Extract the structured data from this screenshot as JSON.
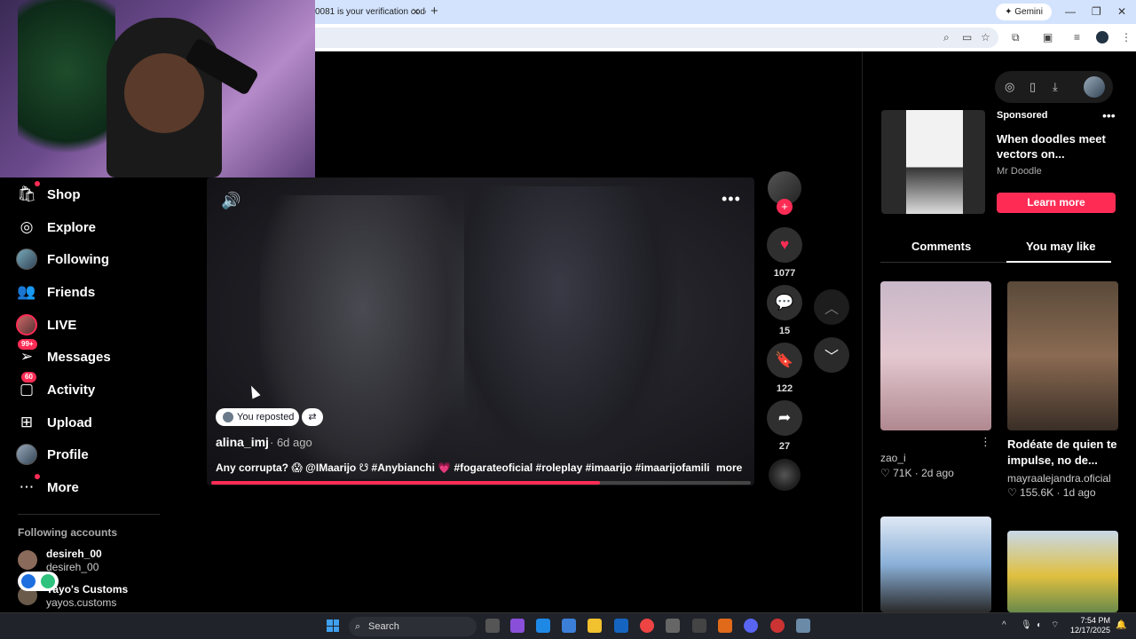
{
  "browser": {
    "tab_title": "0081 is your verification code",
    "gemini_label": "Gemini",
    "new_tab_glyph": "+"
  },
  "sidebar": {
    "items": [
      {
        "label": "Shop",
        "icon": "shop-icon"
      },
      {
        "label": "Explore",
        "icon": "compass-icon"
      },
      {
        "label": "Following",
        "icon": "following-avatar"
      },
      {
        "label": "Friends",
        "icon": "friends-icon"
      },
      {
        "label": "LIVE",
        "icon": "live-avatar"
      },
      {
        "label": "Messages",
        "icon": "messages-icon",
        "badge": "99+"
      },
      {
        "label": "Activity",
        "icon": "activity-icon",
        "badge": "60"
      },
      {
        "label": "Upload",
        "icon": "upload-icon"
      },
      {
        "label": "Profile",
        "icon": "profile-avatar"
      },
      {
        "label": "More",
        "icon": "more-icon"
      }
    ],
    "following_header": "Following accounts",
    "accounts": [
      {
        "name": "desireh_00",
        "username": "desireh_00"
      },
      {
        "name": "Yayo's Customs",
        "username": "yayos.customs"
      }
    ]
  },
  "video": {
    "repost_label": "You reposted",
    "author": "alina_imj",
    "time_ago": "· 6d ago",
    "caption": "Any corrupta? 😱 @IMaarijo ☋ #Anybianchi 💗 #fogarateoficial #roleplay #imaarijo #imaarijofamili ...",
    "more_label": "more",
    "progress": 0.72
  },
  "actions": {
    "likes": "1077",
    "comments": "15",
    "saves": "122",
    "shares": "27"
  },
  "ad": {
    "sponsored": "Sponsored",
    "title": "When doodles meet vectors on...",
    "brand": "Mr Doodle",
    "cta": "Learn more"
  },
  "panel_tabs": {
    "comments": "Comments",
    "you_may_like": "You may like"
  },
  "recommendations": [
    {
      "author": "zao_i",
      "meta": "♡ 71K · 2d ago"
    },
    {
      "title": "Rodéate de quien te impulse, no de...",
      "author": "mayraalejandra.oficial",
      "meta": "♡ 155.6K · 1d ago"
    }
  ],
  "taskbar": {
    "search_placeholder": "Search",
    "time": "7:54 PM",
    "date": "12/17/2025"
  },
  "colors": {
    "accent": "#fe2c55",
    "background": "#000000",
    "tabbar": "#d3e3fd"
  }
}
